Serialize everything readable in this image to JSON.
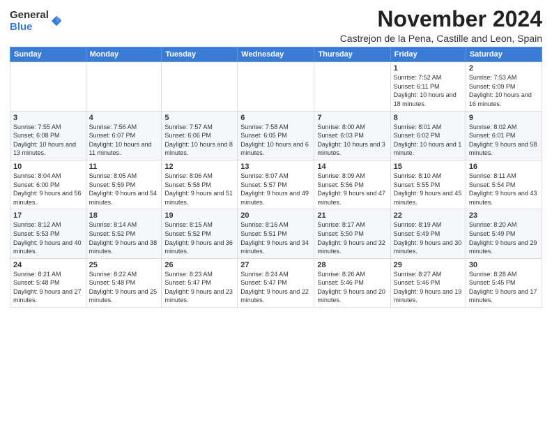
{
  "logo": {
    "general": "General",
    "blue": "Blue"
  },
  "title": "November 2024",
  "location": "Castrejon de la Pena, Castille and Leon, Spain",
  "weekdays": [
    "Sunday",
    "Monday",
    "Tuesday",
    "Wednesday",
    "Thursday",
    "Friday",
    "Saturday"
  ],
  "weeks": [
    [
      {
        "day": "",
        "info": ""
      },
      {
        "day": "",
        "info": ""
      },
      {
        "day": "",
        "info": ""
      },
      {
        "day": "",
        "info": ""
      },
      {
        "day": "",
        "info": ""
      },
      {
        "day": "1",
        "info": "Sunrise: 7:52 AM\nSunset: 6:11 PM\nDaylight: 10 hours and 18 minutes."
      },
      {
        "day": "2",
        "info": "Sunrise: 7:53 AM\nSunset: 6:09 PM\nDaylight: 10 hours and 16 minutes."
      }
    ],
    [
      {
        "day": "3",
        "info": "Sunrise: 7:55 AM\nSunset: 6:08 PM\nDaylight: 10 hours and 13 minutes."
      },
      {
        "day": "4",
        "info": "Sunrise: 7:56 AM\nSunset: 6:07 PM\nDaylight: 10 hours and 11 minutes."
      },
      {
        "day": "5",
        "info": "Sunrise: 7:57 AM\nSunset: 6:06 PM\nDaylight: 10 hours and 8 minutes."
      },
      {
        "day": "6",
        "info": "Sunrise: 7:58 AM\nSunset: 6:05 PM\nDaylight: 10 hours and 6 minutes."
      },
      {
        "day": "7",
        "info": "Sunrise: 8:00 AM\nSunset: 6:03 PM\nDaylight: 10 hours and 3 minutes."
      },
      {
        "day": "8",
        "info": "Sunrise: 8:01 AM\nSunset: 6:02 PM\nDaylight: 10 hours and 1 minute."
      },
      {
        "day": "9",
        "info": "Sunrise: 8:02 AM\nSunset: 6:01 PM\nDaylight: 9 hours and 58 minutes."
      }
    ],
    [
      {
        "day": "10",
        "info": "Sunrise: 8:04 AM\nSunset: 6:00 PM\nDaylight: 9 hours and 56 minutes."
      },
      {
        "day": "11",
        "info": "Sunrise: 8:05 AM\nSunset: 5:59 PM\nDaylight: 9 hours and 54 minutes."
      },
      {
        "day": "12",
        "info": "Sunrise: 8:06 AM\nSunset: 5:58 PM\nDaylight: 9 hours and 51 minutes."
      },
      {
        "day": "13",
        "info": "Sunrise: 8:07 AM\nSunset: 5:57 PM\nDaylight: 9 hours and 49 minutes."
      },
      {
        "day": "14",
        "info": "Sunrise: 8:09 AM\nSunset: 5:56 PM\nDaylight: 9 hours and 47 minutes."
      },
      {
        "day": "15",
        "info": "Sunrise: 8:10 AM\nSunset: 5:55 PM\nDaylight: 9 hours and 45 minutes."
      },
      {
        "day": "16",
        "info": "Sunrise: 8:11 AM\nSunset: 5:54 PM\nDaylight: 9 hours and 43 minutes."
      }
    ],
    [
      {
        "day": "17",
        "info": "Sunrise: 8:12 AM\nSunset: 5:53 PM\nDaylight: 9 hours and 40 minutes."
      },
      {
        "day": "18",
        "info": "Sunrise: 8:14 AM\nSunset: 5:52 PM\nDaylight: 9 hours and 38 minutes."
      },
      {
        "day": "19",
        "info": "Sunrise: 8:15 AM\nSunset: 5:52 PM\nDaylight: 9 hours and 36 minutes."
      },
      {
        "day": "20",
        "info": "Sunrise: 8:16 AM\nSunset: 5:51 PM\nDaylight: 9 hours and 34 minutes."
      },
      {
        "day": "21",
        "info": "Sunrise: 8:17 AM\nSunset: 5:50 PM\nDaylight: 9 hours and 32 minutes."
      },
      {
        "day": "22",
        "info": "Sunrise: 8:19 AM\nSunset: 5:49 PM\nDaylight: 9 hours and 30 minutes."
      },
      {
        "day": "23",
        "info": "Sunrise: 8:20 AM\nSunset: 5:49 PM\nDaylight: 9 hours and 29 minutes."
      }
    ],
    [
      {
        "day": "24",
        "info": "Sunrise: 8:21 AM\nSunset: 5:48 PM\nDaylight: 9 hours and 27 minutes."
      },
      {
        "day": "25",
        "info": "Sunrise: 8:22 AM\nSunset: 5:48 PM\nDaylight: 9 hours and 25 minutes."
      },
      {
        "day": "26",
        "info": "Sunrise: 8:23 AM\nSunset: 5:47 PM\nDaylight: 9 hours and 23 minutes."
      },
      {
        "day": "27",
        "info": "Sunrise: 8:24 AM\nSunset: 5:47 PM\nDaylight: 9 hours and 22 minutes."
      },
      {
        "day": "28",
        "info": "Sunrise: 8:26 AM\nSunset: 5:46 PM\nDaylight: 9 hours and 20 minutes."
      },
      {
        "day": "29",
        "info": "Sunrise: 8:27 AM\nSunset: 5:46 PM\nDaylight: 9 hours and 19 minutes."
      },
      {
        "day": "30",
        "info": "Sunrise: 8:28 AM\nSunset: 5:45 PM\nDaylight: 9 hours and 17 minutes."
      }
    ]
  ]
}
